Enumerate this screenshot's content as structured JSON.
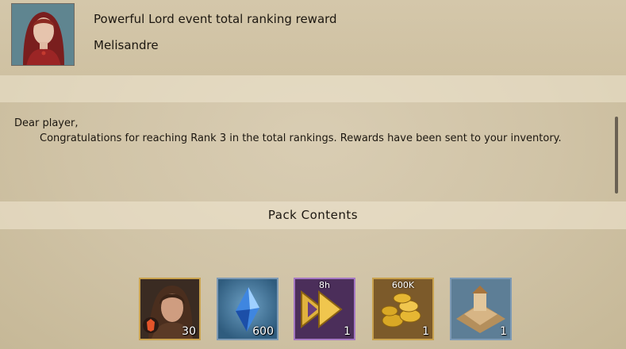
{
  "mail": {
    "title": "Powerful Lord event total ranking reward",
    "sender": "Melisandre",
    "greeting": "Dear player,",
    "message": "Congratulations for reaching Rank 3 in the total rankings. Rewards have been sent to your inventory."
  },
  "pack": {
    "header": "Pack Contents",
    "items": [
      {
        "icon": "hero-portrait-icon",
        "quantity": "30",
        "badge": ""
      },
      {
        "icon": "blue-crystal-icon",
        "quantity": "600",
        "badge": ""
      },
      {
        "icon": "speedup-arrows-icon",
        "quantity": "1",
        "badge": "8h"
      },
      {
        "icon": "gold-coins-icon",
        "quantity": "1",
        "badge": "600K"
      },
      {
        "icon": "building-icon",
        "quantity": "1",
        "badge": ""
      }
    ]
  }
}
